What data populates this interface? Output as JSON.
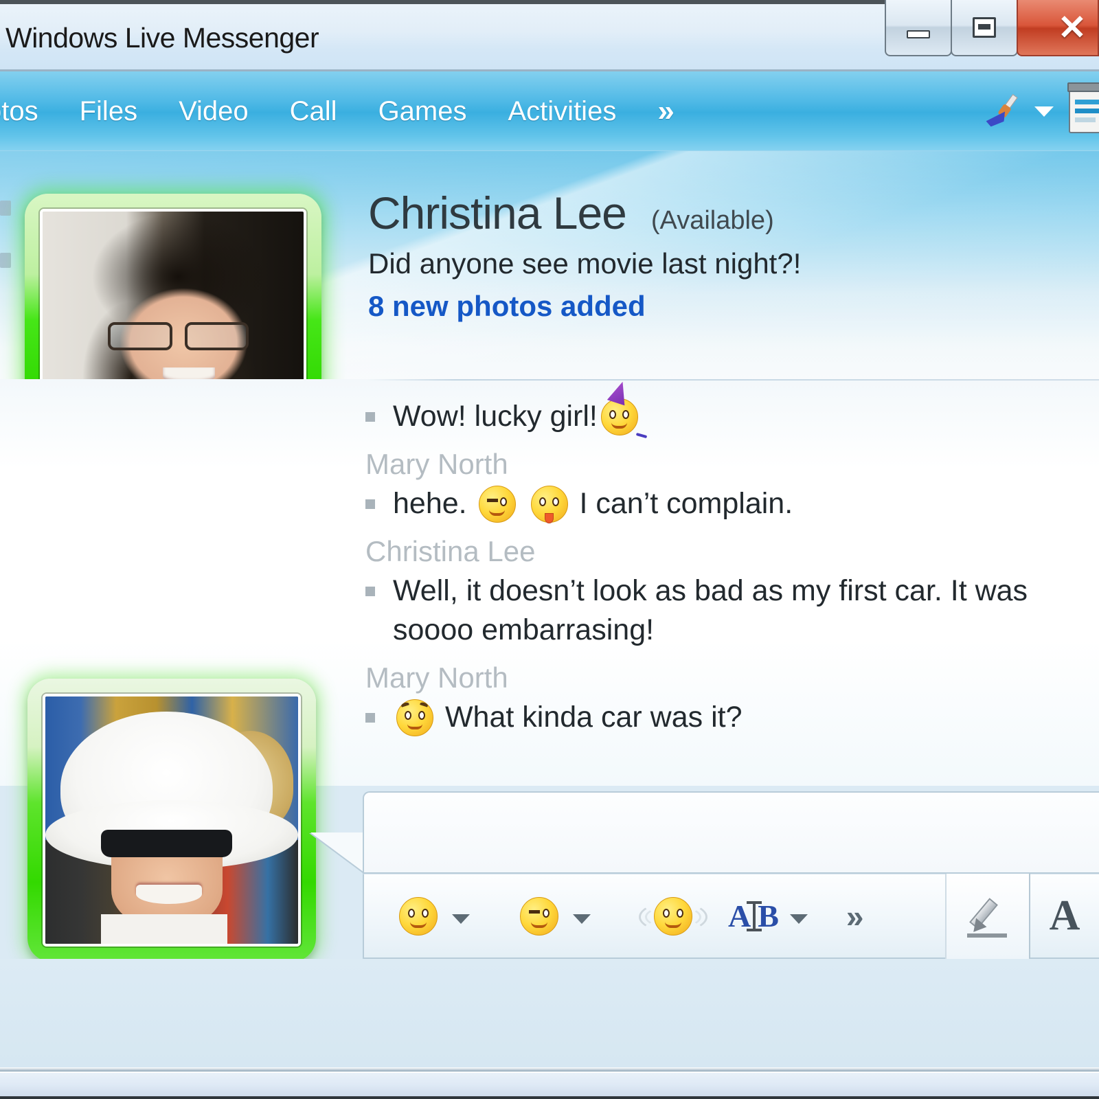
{
  "window": {
    "title": "Windows Live Messenger",
    "controls": {
      "minimize": "–",
      "maximize": "□",
      "close": "✕"
    }
  },
  "menubar": {
    "items": [
      {
        "label": "otos",
        "name": "menu-photos"
      },
      {
        "label": "Files",
        "name": "menu-files"
      },
      {
        "label": "Video",
        "name": "menu-video"
      },
      {
        "label": "Call",
        "name": "menu-call"
      },
      {
        "label": "Games",
        "name": "menu-games"
      },
      {
        "label": "Activities",
        "name": "menu-activities"
      },
      {
        "label": "»",
        "name": "menu-overflow"
      }
    ],
    "brush_icon": "paintbrush-icon",
    "brush_caret": "chevron-down-icon",
    "doc_icon": "window-layout-icon"
  },
  "contact": {
    "name": "Christina Lee",
    "status": "(Available)",
    "personal_message": "Did anyone see movie last night?!",
    "photos_link": "8 new photos added",
    "status_color": "#3ad800",
    "display_picture": "christina-lee-photo"
  },
  "self": {
    "display_picture": "mary-north-photo",
    "status_color": "#3ad800"
  },
  "conversation": [
    {
      "type": "message",
      "sender": "",
      "text_before": "Wow! lucky girl!",
      "text_after": "",
      "emoticons": [
        "party-hat-face"
      ]
    },
    {
      "type": "sender",
      "sender": "Mary North"
    },
    {
      "type": "message",
      "text_before": "hehe.",
      "text_after": "I can’t complain.",
      "emoticons": [
        "winking-face",
        "tongue-out-face"
      ]
    },
    {
      "type": "sender",
      "sender": "Christina Lee"
    },
    {
      "type": "message",
      "text_before": "Well, it doesn’t look as bad as my first car. It was soooo embarrasing!",
      "text_after": "",
      "emoticons": []
    },
    {
      "type": "sender",
      "sender": "Mary North"
    },
    {
      "type": "message",
      "text_before": "",
      "text_after": "What kinda car was it?",
      "emoticons": [
        "raised-eyebrow-face"
      ]
    }
  ],
  "input": {
    "value": "",
    "placeholder": ""
  },
  "toolbar": {
    "emoticon_button": "smiley-icon",
    "emoticon_caret": "chevron-down-icon",
    "wink_button": "winking-smiley-icon",
    "wink_caret": "chevron-down-icon",
    "nudge_button": "nudge-icon",
    "font_button_a": "A",
    "font_button_b": "B",
    "font_caret": "chevron-down-icon",
    "more_button": "»",
    "handwriting_button": "pencil-icon",
    "text_button": "A"
  }
}
